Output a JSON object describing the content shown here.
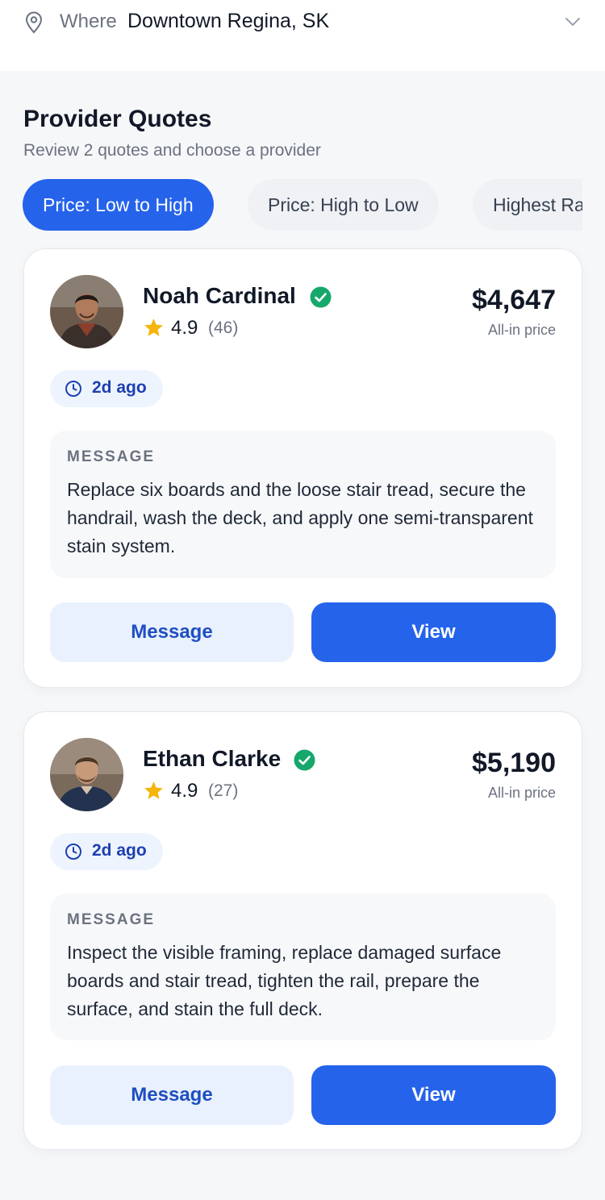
{
  "location": {
    "label": "Where",
    "value": "Downtown Regina, SK"
  },
  "header": {
    "title": "Provider Quotes",
    "subtitle": "Review 2 quotes and choose a provider"
  },
  "sort_options": [
    {
      "label": "Price: Low to High",
      "active": true
    },
    {
      "label": "Price: High to Low",
      "active": false
    },
    {
      "label": "Highest Rated",
      "active": false
    }
  ],
  "quotes": [
    {
      "name": "Noah Cardinal",
      "verified": true,
      "rating": "4.9",
      "reviews": "(46)",
      "price": "$4,647",
      "price_label": "All-in price",
      "time": "2d ago",
      "message_heading": "MESSAGE",
      "message": "Replace six boards and the loose stair tread, secure the handrail, wash the deck, and apply one semi-transparent stain system.",
      "message_button": "Message",
      "view_button": "View"
    },
    {
      "name": "Ethan Clarke",
      "verified": true,
      "rating": "4.9",
      "reviews": "(27)",
      "price": "$5,190",
      "price_label": "All-in price",
      "time": "2d ago",
      "message_heading": "MESSAGE",
      "message": "Inspect the visible framing, replace damaged surface boards and stair tread, tighten the rail, prepare the surface, and stain the full deck.",
      "message_button": "Message",
      "view_button": "View"
    }
  ],
  "colors": {
    "accent": "#2563eb",
    "verified": "#16a86b",
    "star": "#f5b50a"
  },
  "icons": [
    "map-pin-icon",
    "chevron-down-icon",
    "verified-check-icon",
    "star-icon",
    "clock-icon"
  ]
}
